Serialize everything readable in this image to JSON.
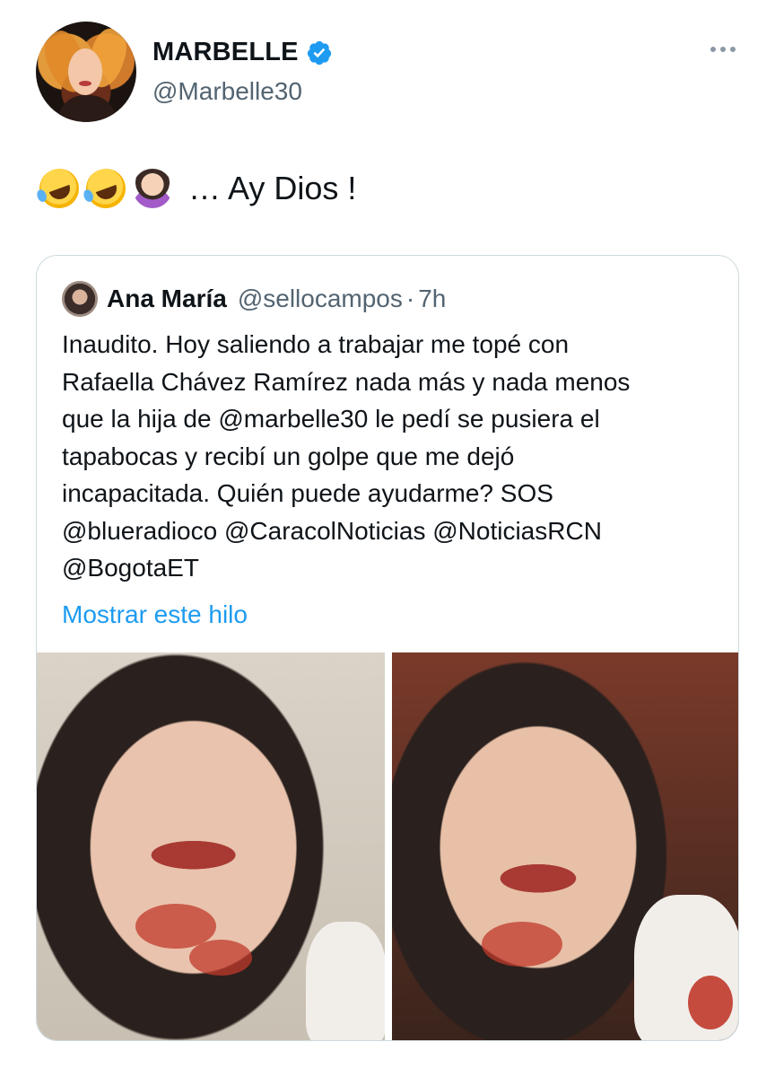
{
  "tweet": {
    "display_name": "MARBELLE",
    "handle": "@Marbelle30",
    "text": "… Ay Dios !",
    "emojis": [
      "rolling-on-floor-laughing-icon",
      "rolling-on-floor-laughing-icon",
      "woman-facepalming-icon"
    ]
  },
  "quote": {
    "display_name": "Ana María",
    "handle": "@sellocampos",
    "separator": "·",
    "time": "7h",
    "lines": [
      "Inaudito. Hoy saliendo a trabajar me topé con",
      "Rafaella Chávez Ramírez nada más y nada menos",
      "que la hija de @marbelle30 le pedí se pusiera el",
      "tapabocas y recibí un golpe que me dejó",
      "incapacitada. Quién puede ayudarme? SOS",
      "@blueradioco @CaracolNoticias  @NoticiasRCN",
      "@BogotaET"
    ],
    "show_thread": "Mostrar este hilo"
  },
  "colors": {
    "link": "#1d9bf0",
    "secondary_text": "#536471",
    "verified": "#1d9bf0",
    "border": "#cfd9de"
  }
}
